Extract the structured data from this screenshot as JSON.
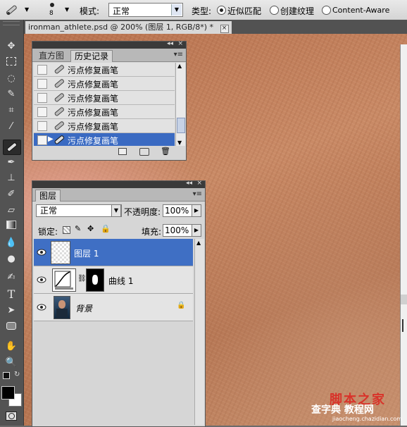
{
  "options": {
    "tool_size": "8",
    "mode_label": "模式:",
    "mode_value": "正常",
    "type_label": "类型:",
    "type_options": [
      "近似匹配",
      "创建纹理",
      "Content-Aware"
    ],
    "selected_type": "近似匹配"
  },
  "document": {
    "tab_title": "ironman_athlete.psd @ 200% (图层 1, RGB/8*) *",
    "close": "×"
  },
  "history_panel": {
    "tabs": [
      "直方图",
      "历史记录"
    ],
    "active_tab": "历史记录",
    "items": [
      "污点修复画笔",
      "污点修复画笔",
      "污点修复画笔",
      "污点修复画笔",
      "污点修复画笔",
      "污点修复画笔"
    ],
    "selected_index": 5
  },
  "layers_panel": {
    "tab": "图层",
    "blend_mode": "正常",
    "opacity_label": "不透明度:",
    "opacity_value": "100%",
    "lock_label": "锁定:",
    "fill_label": "填充:",
    "fill_value": "100%",
    "layers": [
      {
        "name": "图层 1",
        "selected": true
      },
      {
        "name": "曲线 1",
        "selected": false
      },
      {
        "name": "背景",
        "selected": false,
        "locked": true
      }
    ]
  },
  "watermark": {
    "text": "脚本之家",
    "text2": "查字典 教程网",
    "url": "jiaocheng.chazidian.com"
  },
  "colors": {
    "accent": "#3f6fc4",
    "toolbox_bg": "#535353",
    "panel_bg": "#d6d6d6"
  }
}
